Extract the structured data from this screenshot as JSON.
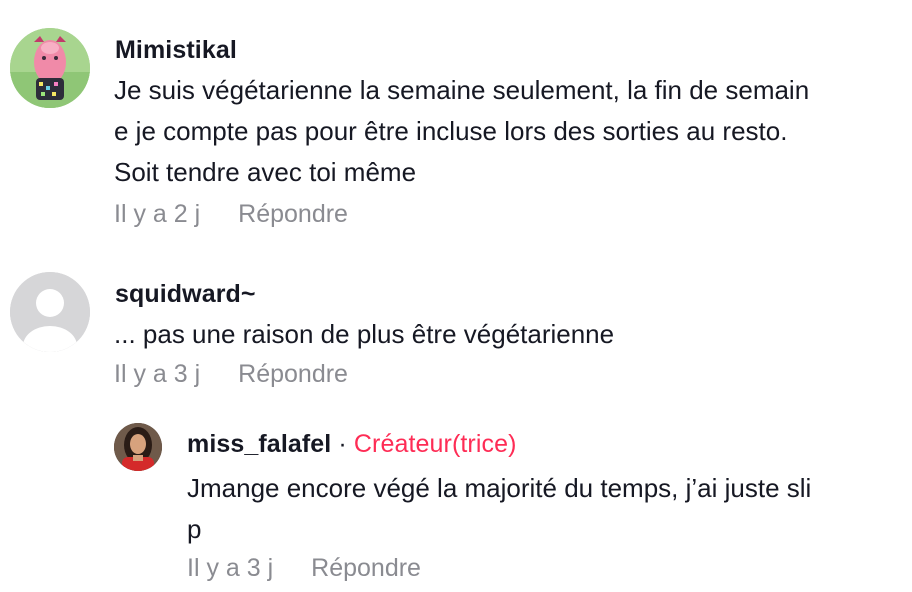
{
  "comments": [
    {
      "username": "Mimistikal",
      "text_lines": [
        "Je suis végétarienne la semaine seulement, la fin de semain",
        "e je compte pas pour être incluse lors des sorties au resto.",
        "Soit tendre avec toi même"
      ],
      "time": "Il y a 2 j",
      "reply_label": "Répondre"
    },
    {
      "username": "squidward~",
      "text_lines": [
        "... pas une raison de plus être végétarienne"
      ],
      "time": "Il y a 3 j",
      "reply_label": "Répondre"
    }
  ],
  "reply": {
    "username": "miss_falafel",
    "separator": " · ",
    "badge": "Créateur(trice)",
    "text_lines": [
      "Jmange encore végé la majorité du temps, j’ai juste sli",
      "p"
    ],
    "time": "Il y a 3 j",
    "reply_label": "Répondre"
  },
  "colors": {
    "creator_badge": "#fe2c55",
    "meta_text": "#8a8b91",
    "default_avatar": "#d6d6d8"
  }
}
